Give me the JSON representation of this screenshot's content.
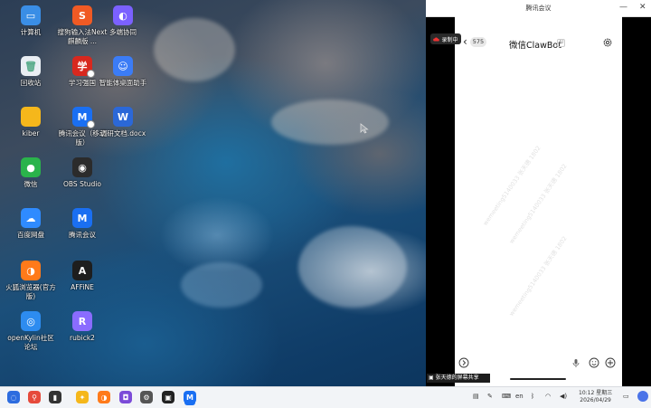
{
  "desktop": {
    "icons": [
      {
        "label": "计算机",
        "icon": "computer-icon",
        "color": "#3a8ee6"
      },
      {
        "label": "搜狗输入法Next麒麟版 ...",
        "icon": "sogou-icon",
        "color": "#f05a24"
      },
      {
        "label": "多端协同",
        "icon": "multi-device-icon",
        "color": "#7b61ff"
      },
      {
        "label": "回收站",
        "icon": "trash-icon",
        "color": "#e9eef3"
      },
      {
        "label": "学习强国",
        "icon": "xuexi-icon",
        "color": "#d8281e"
      },
      {
        "label": "智能体桌面助手",
        "icon": "assistant-icon",
        "color": "#3b7cf6"
      },
      {
        "label": "kiber",
        "icon": "folder-icon",
        "color": "#f5b71b"
      },
      {
        "label": "腾讯会议（移动版）",
        "icon": "tencent-meeting-icon",
        "color": "#1a6ff2"
      },
      {
        "label": "调研文档.docx",
        "icon": "docx-icon",
        "color": "#2b68d8"
      },
      {
        "label": "微信",
        "icon": "wechat-icon",
        "color": "#2ab34b"
      },
      {
        "label": "OBS Studio",
        "icon": "obs-icon",
        "color": "#2b2b2b"
      },
      {
        "label": "百度网盘",
        "icon": "baidu-netdisk-icon",
        "color": "#2f8bff"
      },
      {
        "label": "腾讯会议",
        "icon": "tencent-meeting-icon",
        "color": "#1a6ff2"
      },
      {
        "label": "火狐浏览器(官方版)",
        "icon": "firefox-icon",
        "color": "#ff7a1a"
      },
      {
        "label": "AFFiNE",
        "icon": "affine-icon",
        "color": "#1e1e1e"
      },
      {
        "label": "openKylin社区论坛",
        "icon": "openkylin-icon",
        "color": "#2d8cf0"
      },
      {
        "label": "rubick2",
        "icon": "rubick-icon",
        "color": "#8a6cff"
      }
    ]
  },
  "meeting_window": {
    "title": "腾讯会议",
    "record_badge": "录制中",
    "unread_count": "575",
    "chat_title": "微信ClawBot",
    "ai_tag": "AI",
    "watermark": "wemeeting5140033 张天德 1802",
    "share_banner": "张天德的屏幕共享"
  },
  "taskbar": {
    "apps": [
      "kylin-start-icon",
      "search-icon",
      "multitask-icon",
      "app-store-icon",
      "firefox-icon",
      "camera-icon",
      "settings-icon",
      "terminal-icon",
      "tencent-meeting-icon"
    ],
    "tray_lang": "en",
    "time": "10:12 星期三",
    "date": "2026/04/29"
  }
}
